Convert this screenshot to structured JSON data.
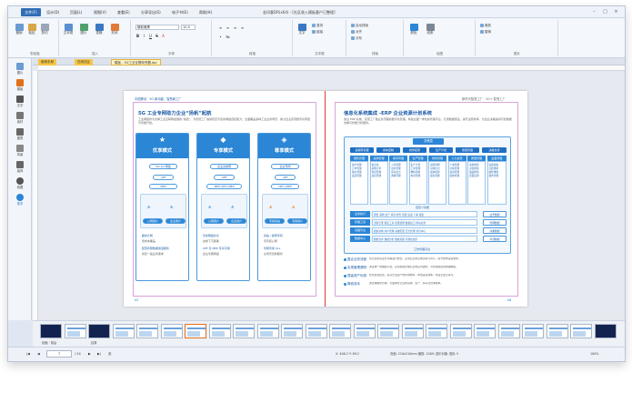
{
  "window": {
    "title": "金印客DR(x64) - [社区收入模板客户已整理]",
    "file_tab": "文件(F)",
    "menu": [
      "设计(D)",
      "页面(L)",
      "视图(V)",
      "查看(E)",
      "分享导出(S)",
      "电子书(E)",
      "帮助(H)"
    ]
  },
  "ribbon": {
    "groups": [
      {
        "label": "剪贴板",
        "buttons": [
          "撤销",
          "粘贴",
          "剪切"
        ]
      },
      {
        "label": "插入",
        "buttons": [
          "文本框",
          "图片",
          "表格",
          "形状"
        ]
      },
      {
        "label": "字体",
        "font": "微软雅黑",
        "size": "10.5"
      },
      {
        "label": "段落"
      },
      {
        "label": "文本框",
        "buttons": [
          "文字",
          "竖排",
          "链接"
        ]
      },
      {
        "label": "排版",
        "buttons": [
          "自动排版",
          "对齐",
          "分布"
        ]
      },
      {
        "label": "绘图",
        "buttons": [
          "颜色",
          "线条"
        ]
      },
      {
        "label": "图片",
        "buttons": [
          "裁剪",
          "替换"
        ]
      }
    ],
    "format_buttons": [
      "B",
      "I",
      "U",
      "S",
      "A"
    ]
  },
  "sidebar": {
    "items": [
      "图片",
      "模板",
      "文字",
      "素材",
      "图表",
      "背景",
      "装饰",
      "收藏",
      "更多"
    ]
  },
  "doc_tabs": [
    "使用手册",
    "在线社区",
    "模板 - 5G工业互联网专题.dpr"
  ],
  "spread": {
    "left": {
      "tag": "中国移动 · 5G 新动能，智慧新工厂",
      "heading": "5G 工业专网助力企业“扬帆”起航",
      "intro": "工业网络作为支撑工业互联网发展的“基础”，为智慧工厂提供稳定可靠的网络连接能力，全面覆盖多种工业业务场景，助力企业实现数字化转型与智能升级。",
      "cards": [
        {
          "glyph": "★",
          "title": "优享模式",
          "tag1": "5G SA 网络",
          "tag2": "UPF",
          "tag3": "MEP",
          "users": [
            "公网用户",
            "企业用户"
          ],
          "notes": [
            "· 面向大网",
            "· 低成本覆盖",
            "· 配置有限数据通道服务",
            "· 满足一般业务需求"
          ]
        },
        {
          "glyph": "◆",
          "title": "专享模式",
          "tag1": "企业边缘网",
          "tag2": "UPF",
          "tag3": "MEP  UPF+MEP",
          "users": [
            "公网用户",
            "企业用户"
          ],
          "notes": [
            "· 无线网络共享",
            "· 边缘下沉部署",
            "· UPF 及 MEP 专享可用",
            "· 企业专属网络"
          ]
        },
        {
          "glyph": "◈",
          "title": "尊享模式",
          "tag1": "企业专网",
          "tag2": "UPF",
          "tag3": "UPF+MEP",
          "users": [
            "专用基站",
            "专用用户"
          ],
          "notes": [
            "· 基站 / 频率专有",
            "· 专有核心网",
            "· 专网专用 ULL",
            "· 全场景定制服务"
          ]
        }
      ],
      "page_no": "05"
    },
    "right": {
      "tag": "新时代智慧工厂 · 5G+ 智慧工厂",
      "heading": "信息化系统集成 -ERP 企业资源计划系统",
      "intro": "通过 ERP 系统，实现工厂各业务流程的数字化管理，构建全面一体化的管理平台，打通数据孤岛，提升运营效率，为企业决策提供可靠数据支撑与智能分析服务。",
      "diagram": {
        "title": "决策层",
        "tabs": [
          "进销存管理",
          "成本控制",
          "财务核算",
          "生产计划",
          "质量管理",
          "决策支持"
        ],
        "columns": [
          {
            "head": "销售管理",
            "items": [
              "客户管理",
              "订单管理",
              "报价管理",
              "发货管理"
            ]
          },
          {
            "head": "采购管理",
            "items": [
              "供应商",
              "采购订单",
              "到货管理",
              "退货管理"
            ]
          },
          {
            "head": "库存管理",
            "items": [
              "入库管理",
              "出库管理",
              "库存盘点",
              "调拨管理"
            ]
          },
          {
            "head": "生产管理",
            "items": [
              "生产计划",
              "工单管理",
              "物料需求",
              "车间管理"
            ]
          },
          {
            "head": "财务管理",
            "items": [
              "总账管理",
              "应收应付",
              "成本核算",
              "报表管理"
            ]
          },
          {
            "head": "人力资源",
            "items": [
              "人事管理",
              "考勤管理",
              "薪资管理",
              "绩效管理"
            ]
          },
          {
            "head": "质量管理",
            "items": [
              "来料检验",
              "过程检验",
              "成品检验",
              "质量追溯"
            ]
          },
          {
            "head": "设备管理",
            "items": [
              "设备档案",
              "点检维护",
              "故障维修",
              "备件管理"
            ]
          }
        ],
        "middle_label": "自定义功能",
        "rows": [
          {
            "head": "业务执行",
            "body": "销售  采购  生产  库存  财务  质量  设备  人事  报表"
          },
          {
            "head": "管理工具",
            "body": "流程引擎  报表工具  权限管理  数据接口  移动应用"
          },
          {
            "head": "基础平台",
            "body": "组织架构  用户管理  系统配置  日志管理  消息中心"
          },
          {
            "head": "数据中心",
            "body": "数据仓库  数据分析  数据挖掘  可视化展示"
          }
        ],
        "sides": [
          "业务数据",
          "管理数据",
          "决策数据",
          "外部数据"
        ],
        "bottom_label": "工作管理平台"
      },
      "bullets": [
        {
          "title": "整合业务流程",
          "body": "将企业各项业务流程进行整合，实现信息的高效流转与共享，提升整体运营效率。"
        },
        {
          "title": "实现管理透明",
          "body": "通过统一的数据平台，实现各级管理信息的实时透明，为管理者提供准确依据。"
        },
        {
          "title": "提高资产利用",
          "body": "优化资源配置，提高企业资产的利用效率，降低运营成本，增强企业竞争力。"
        },
        {
          "title": "降低成本",
          "body": "通过精细化管理，全面降低企业的采购、生产、库存及管理成本。"
        }
      ],
      "page_no": "06"
    }
  },
  "filmstrip": {
    "first_label": "封面 · 前后",
    "second_label": "目录",
    "count": 24
  },
  "statusbar": {
    "page_label": "页",
    "current_page": "7",
    "total": "/ 24",
    "coords": "X: 406.2  Y: 89.2",
    "size": "页面: 210x210mm  缩放: 100%  选中对象: 图片 5",
    "zoom": "100%"
  }
}
